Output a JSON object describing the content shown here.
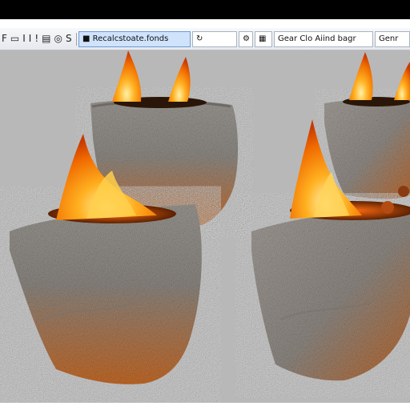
{
  "toolbar": {
    "tool_text_1": "F",
    "tool_text_2": "I",
    "tool_text_3": "I",
    "tool_text_4": "!",
    "tool_text_5": "S",
    "active_field": "Recalcstoate.fonds",
    "field_2": "",
    "field_3": "Gear Clo Aiind bagr",
    "field_4": "Genr"
  },
  "viewport": {
    "background_color": "#b9b8b8",
    "subject": "flaming stone pots"
  }
}
